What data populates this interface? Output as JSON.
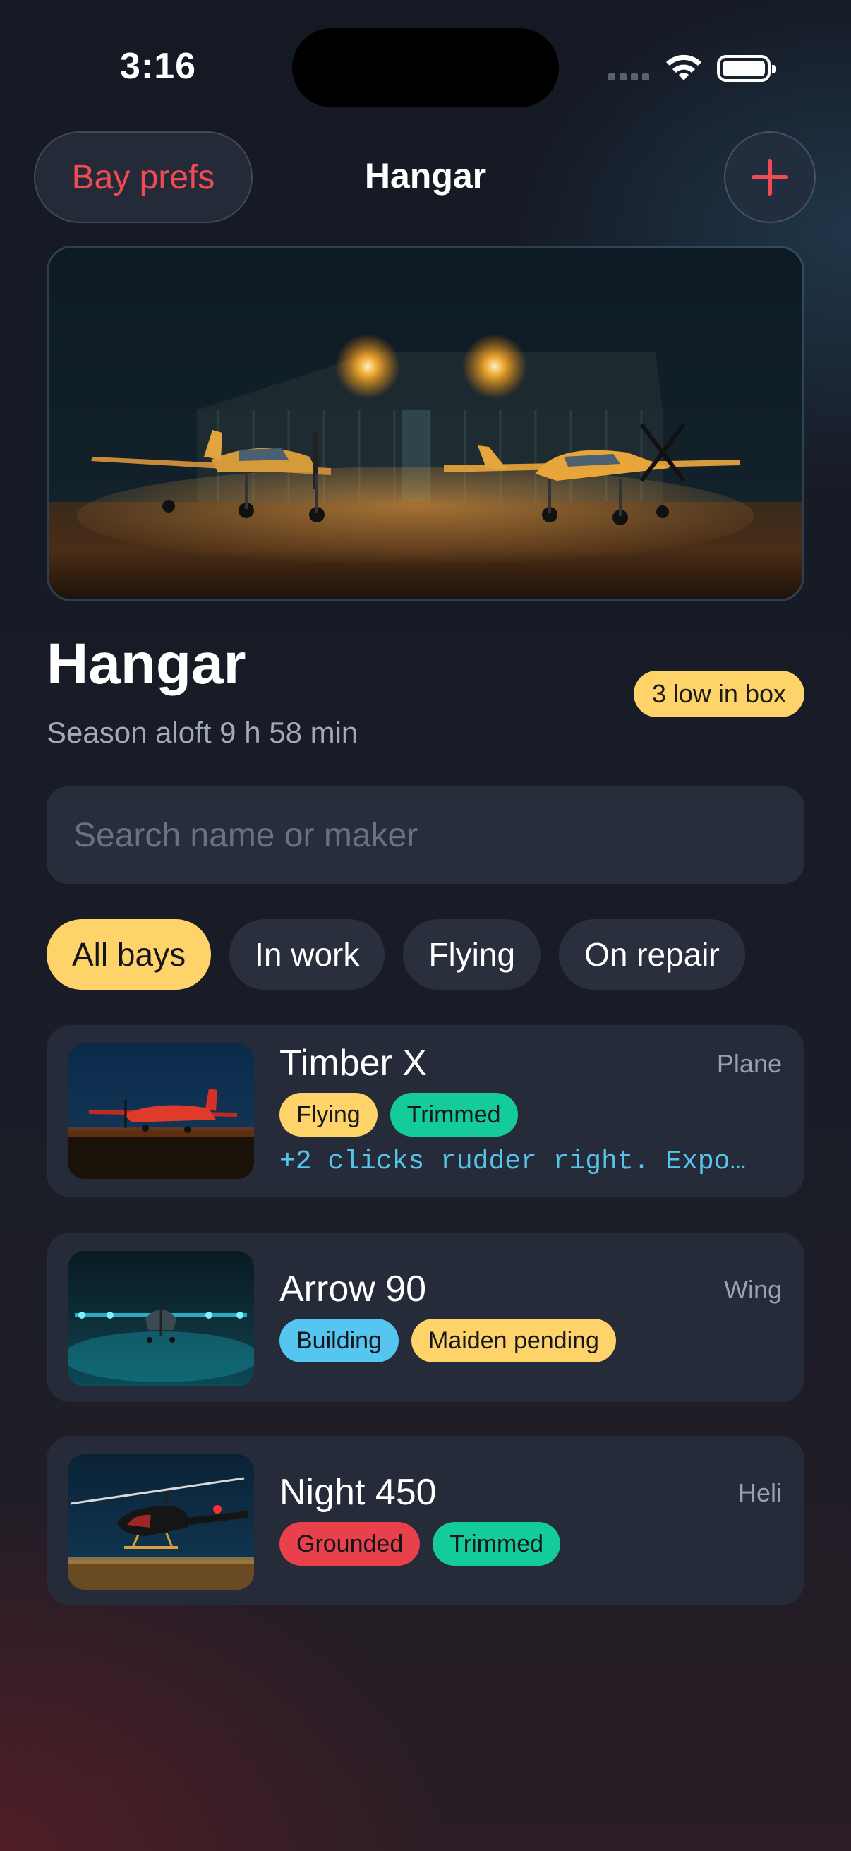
{
  "status_bar": {
    "time": "3:16"
  },
  "nav": {
    "left_label": "Bay prefs",
    "title": "Hangar",
    "add_icon": "plus-icon"
  },
  "header": {
    "title": "Hangar",
    "subtitle": "Season aloft 9 h 58 min",
    "badge": "3 low in box"
  },
  "search": {
    "placeholder": "Search name or maker",
    "value": ""
  },
  "filters": [
    {
      "label": "All bays",
      "active": true
    },
    {
      "label": "In work",
      "active": false
    },
    {
      "label": "Flying",
      "active": false
    },
    {
      "label": "On repair",
      "active": false
    }
  ],
  "aircraft": [
    {
      "name": "Timber X",
      "kind": "Plane",
      "tags": [
        {
          "label": "Flying",
          "color": "#fdd36a"
        },
        {
          "label": "Trimmed",
          "color": "#14cc9a"
        }
      ],
      "note": "+2 clicks rudder right. Expo…"
    },
    {
      "name": "Arrow 90",
      "kind": "Wing",
      "tags": [
        {
          "label": "Building",
          "color": "#55c6ef"
        },
        {
          "label": "Maiden pending",
          "color": "#fdd36a"
        }
      ]
    },
    {
      "name": "Night 450",
      "kind": "Heli",
      "tags": [
        {
          "label": "Grounded",
          "color": "#e8414b"
        },
        {
          "label": "Trimmed",
          "color": "#14cc9a"
        }
      ]
    }
  ],
  "colors": {
    "accent": "#fdd36a",
    "danger": "#ef4b55",
    "card_bg": "#262b3a"
  }
}
